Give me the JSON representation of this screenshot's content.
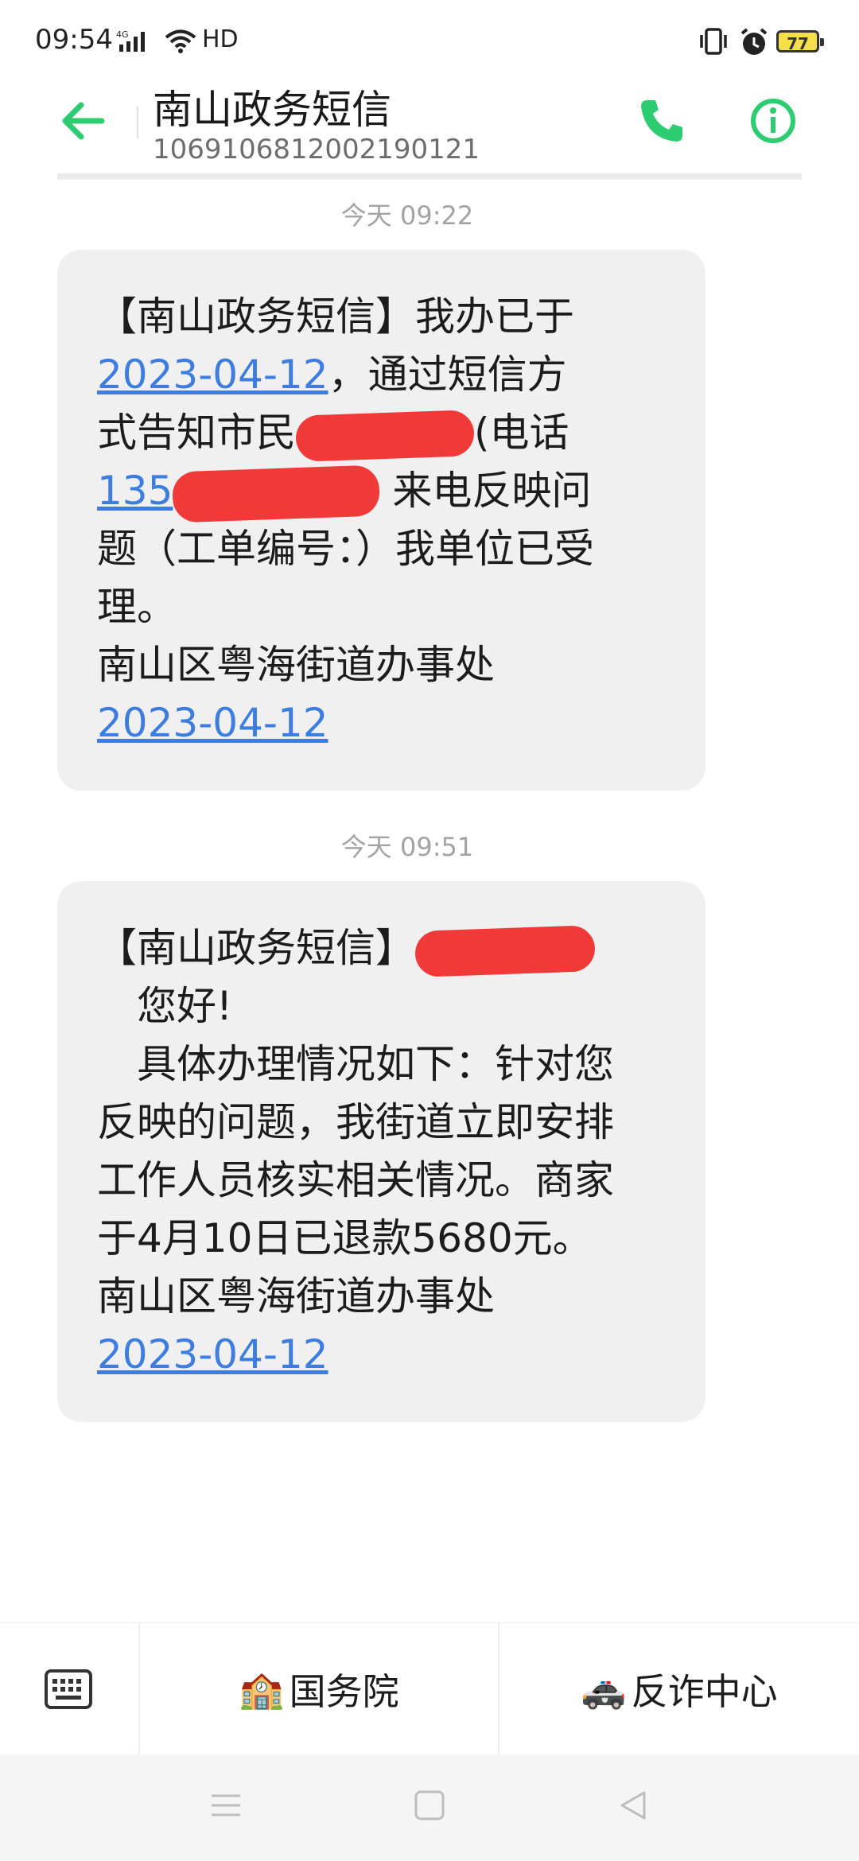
{
  "status_bar": {
    "time": "09:54",
    "network": "4G",
    "hd": "HD",
    "battery": "77"
  },
  "header": {
    "contact_name": "南山政务短信",
    "contact_number": "1069106812002190121",
    "icons": [
      "back-arrow-icon",
      "phone-icon",
      "info-icon"
    ],
    "accent_color": "#2ecc71"
  },
  "messages": [
    {
      "timestamp": "今天 09:22",
      "lines": [
        "【南山政务短信】我办已于",
        "2023-04-12",
        "，通过短信方",
        "式告知市民",
        "(电话",
        "135",
        "来电反映问",
        "题（工单编号：）我单位已受",
        "理。",
        "南山区粤海街道办事处",
        "2023-04-12"
      ]
    },
    {
      "timestamp": "今天 09:51",
      "lines": [
        "【南山政务短信】",
        "　您好!",
        "　具体办理情况如下：针对您",
        "反映的问题，我街道立即安排",
        "工作人员核实相关情况。商家",
        "于4月10日已退款5680元。",
        "南山区粤海街道办事处",
        "2023-04-12"
      ]
    }
  ],
  "bottom_bar": {
    "menu_1": "国务院",
    "menu_1_icon": "🏫",
    "menu_2": "反诈中心",
    "menu_2_icon": "🚓"
  },
  "link_color": "#3d7de0",
  "redaction_color": "#f03a3a"
}
